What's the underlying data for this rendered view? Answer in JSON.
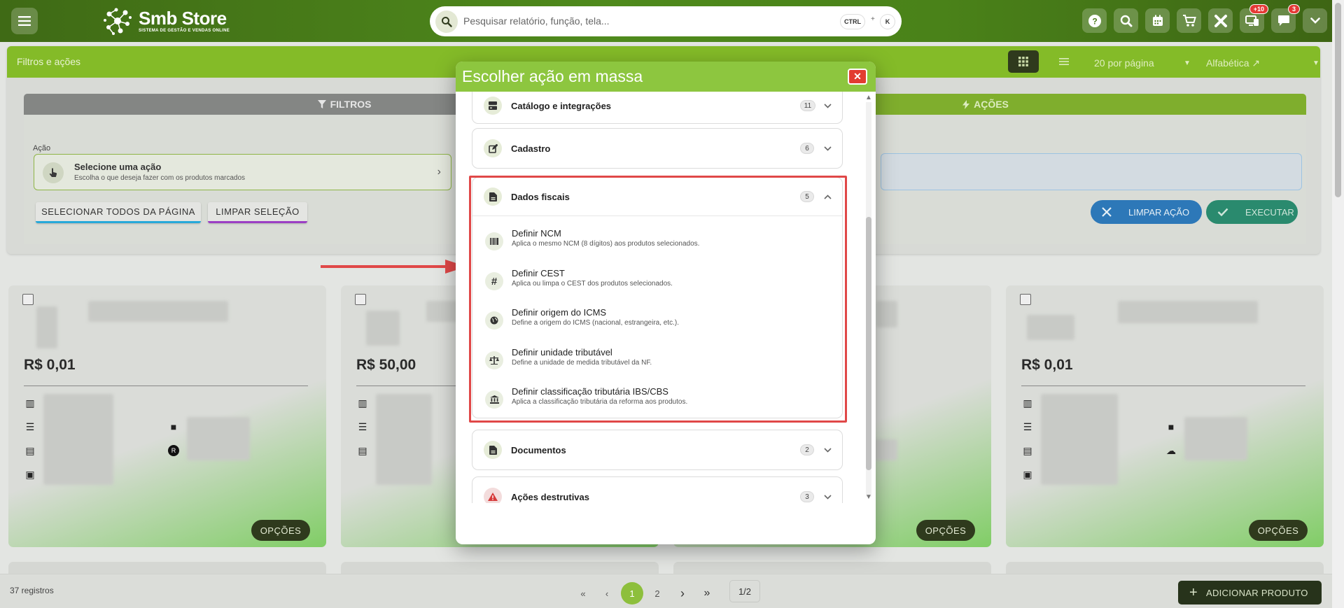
{
  "header": {
    "brand": "Smb Store",
    "brand_sub": "SISTEMA DE GESTÃO E VENDAS ONLINE",
    "search_placeholder": "Pesquisar relatório, função, tela...",
    "kbd_ctrl": "CTRL",
    "kbd_plus": "+",
    "kbd_k": "K",
    "badges": {
      "devices": "+10",
      "messages": "3"
    }
  },
  "filters_panel": {
    "title": "Filtros e ações",
    "per_page": "20 por página",
    "sort": "Alfabética ↗",
    "tab_filters": "FILTROS",
    "tab_actions": "AÇÕES",
    "action_label": "Ação",
    "action_title": "Selecione uma ação",
    "action_sub": "Escolha o que deseja fazer com os produtos marcados",
    "select_all": "SELECIONAR TODOS DA PÁGINA",
    "clear_selection": "LIMPAR SELEÇÃO",
    "clear_action": "LIMPAR AÇÃO",
    "execute": "EXECUTAR"
  },
  "products": [
    {
      "price": "R$ 0,01",
      "options": "OPÇÕES"
    },
    {
      "price": "R$ 50,00",
      "options": "OPÇÕES"
    },
    {
      "price": "",
      "options": "OPÇÕES"
    },
    {
      "price": "R$ 0,01",
      "options": "OPÇÕES"
    }
  ],
  "footer": {
    "records": "37 registros",
    "page1": "1",
    "page2": "2",
    "page_indicator": "1/2",
    "add_product": "ADICIONAR PRODUTO"
  },
  "modal": {
    "title": "Escolher ação em massa",
    "close": "✕",
    "groups": [
      {
        "label": "Catálogo e integrações",
        "count": "11",
        "icon": "storage-icon"
      },
      {
        "label": "Cadastro",
        "count": "6",
        "icon": "edit-icon"
      },
      {
        "label": "Dados fiscais",
        "count": "5",
        "icon": "document-icon"
      },
      {
        "label": "Documentos",
        "count": "2",
        "icon": "document-icon"
      },
      {
        "label": "Ações destrutivas",
        "count": "3",
        "icon": "warning-icon"
      }
    ],
    "fiscal_actions": [
      {
        "title": "Definir NCM",
        "desc": "Aplica o mesmo NCM (8 dígitos) aos produtos selecionados.",
        "icon": "barcode-icon"
      },
      {
        "title": "Definir CEST",
        "desc": "Aplica ou limpa o CEST dos produtos selecionados.",
        "icon": "hash-icon"
      },
      {
        "title": "Definir origem do ICMS",
        "desc": "Define a origem do ICMS (nacional, estrangeira, etc.).",
        "icon": "globe-icon"
      },
      {
        "title": "Definir unidade tributável",
        "desc": "Define a unidade de medida tributável da NF.",
        "icon": "scale-icon"
      },
      {
        "title": "Definir classificação tributária IBS/CBS",
        "desc": "Aplica a classificação tributária da reforma aos produtos.",
        "icon": "bank-icon"
      }
    ]
  },
  "colors": {
    "brand_green": "#4f8a1c",
    "accent": "#8dc63f",
    "danger": "#e23c31"
  }
}
